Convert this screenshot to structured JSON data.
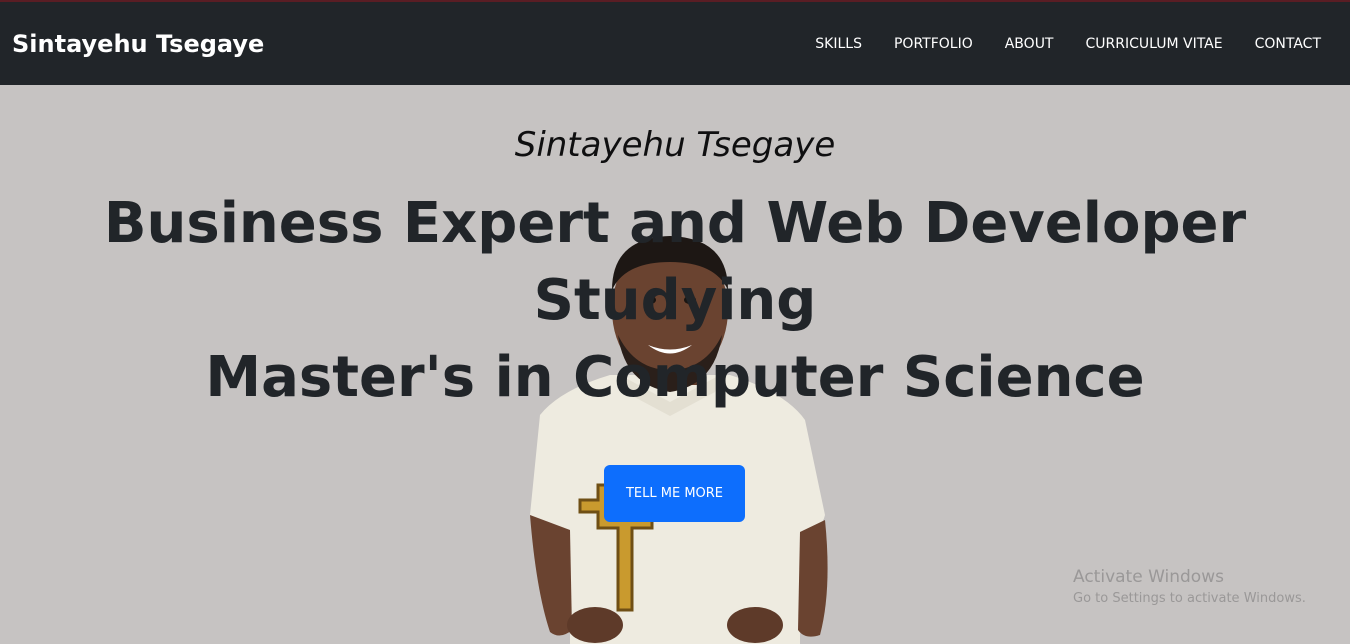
{
  "navbar": {
    "brand": "Sintayehu Tsegaye",
    "items": [
      {
        "label": "SKILLS"
      },
      {
        "label": "PORTFOLIO"
      },
      {
        "label": "ABOUT"
      },
      {
        "label": "CURRICULUM VITAE"
      },
      {
        "label": "CONTACT"
      }
    ]
  },
  "hero": {
    "subheading": "Sintayehu Tsegaye",
    "heading_lines": [
      "Business Expert and Web Developer",
      "Studying",
      "Master's in Computer Science"
    ],
    "button_label": "TELL ME MORE",
    "photo_icon": "person-photo"
  },
  "watermark": {
    "title": "Activate Windows",
    "subtitle": "Go to Settings to activate Windows."
  },
  "colors": {
    "navbar_bg": "#212529",
    "hero_bg": "#c6c3c2",
    "accent": "#0d6efd",
    "heading_text": "#212529"
  }
}
